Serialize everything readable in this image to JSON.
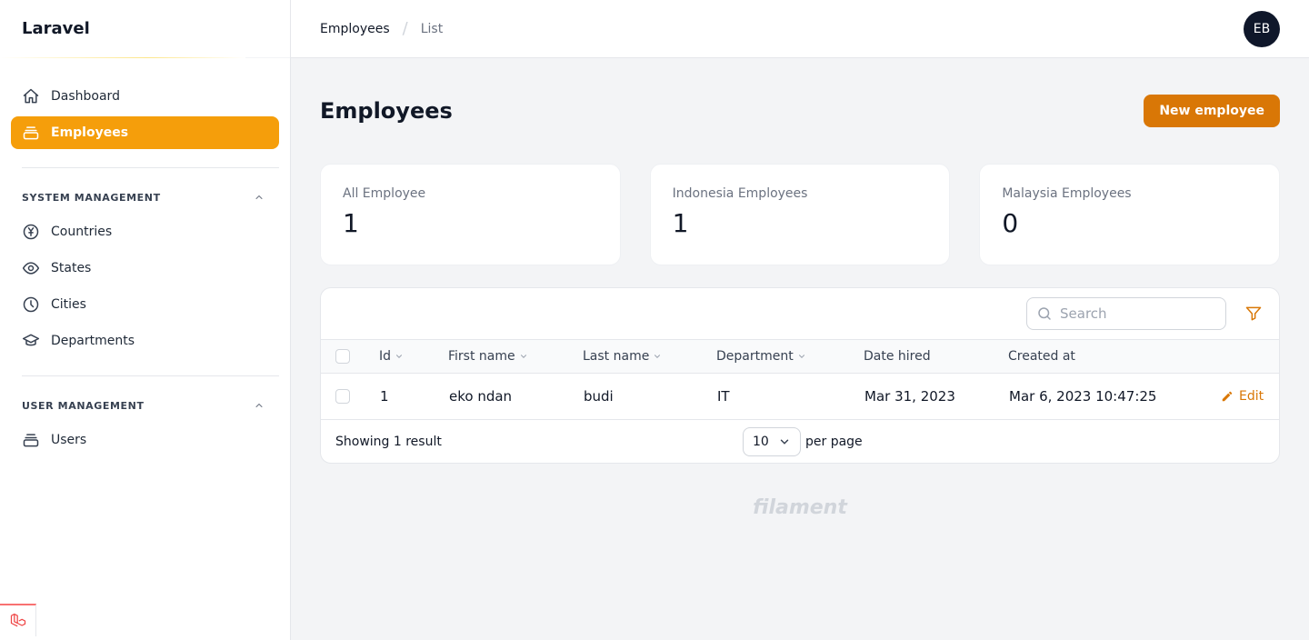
{
  "brand": {
    "name": "Laravel"
  },
  "sidebar": {
    "items": [
      {
        "label": "Dashboard",
        "icon": "home-icon",
        "active": false
      },
      {
        "label": "Employees",
        "icon": "collection-icon",
        "active": true
      }
    ],
    "groups": [
      {
        "title": "SYSTEM MANAGEMENT",
        "items": [
          {
            "label": "Countries",
            "icon": "currency-yen-icon"
          },
          {
            "label": "States",
            "icon": "eye-icon"
          },
          {
            "label": "Cities",
            "icon": "clock-icon"
          },
          {
            "label": "Departments",
            "icon": "academic-cap-icon"
          }
        ]
      },
      {
        "title": "USER MANAGEMENT",
        "items": [
          {
            "label": "Users",
            "icon": "collection-icon"
          }
        ]
      }
    ]
  },
  "topbar": {
    "breadcrumbs": [
      "Employees",
      "List"
    ],
    "avatar_initials": "EB"
  },
  "page": {
    "title": "Employees",
    "new_button": "New employee"
  },
  "stats": [
    {
      "label": "All Employee",
      "value": "1"
    },
    {
      "label": "Indonesia Employees",
      "value": "1"
    },
    {
      "label": "Malaysia Employees",
      "value": "0"
    }
  ],
  "table": {
    "search_placeholder": "Search",
    "columns": [
      "Id",
      "First name",
      "Last name",
      "Department",
      "Date hired",
      "Created at"
    ],
    "rows": [
      {
        "id": "1",
        "first_name": "eko ndan",
        "last_name": "budi",
        "department": "IT",
        "date_hired": "Mar 31, 2023",
        "created_at": "Mar 6, 2023 10:47:25",
        "action": "Edit"
      }
    ],
    "footer": {
      "showing": "Showing 1 result",
      "per_page_value": "10",
      "per_page_label": "per page"
    }
  },
  "footer_brand": "filament",
  "colors": {
    "accent": "#f59e0b",
    "primary_button": "#d97706",
    "avatar_bg": "#0f172a"
  }
}
